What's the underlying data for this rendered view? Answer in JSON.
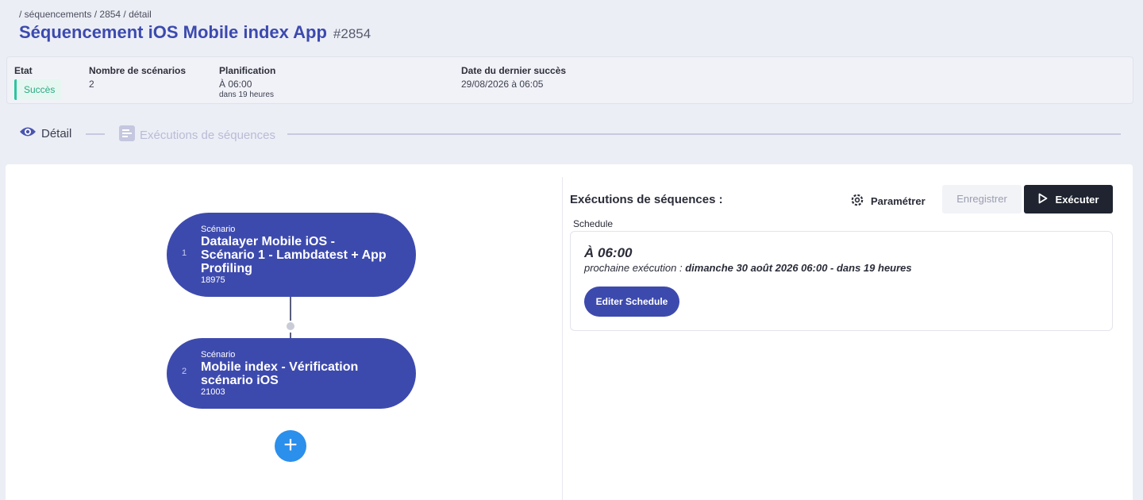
{
  "breadcrumb": "/ séquencements / 2854 / détail",
  "title": "Séquencement iOS Mobile index App",
  "title_id": "#2854",
  "info": {
    "etat_label": "Etat",
    "etat_value": "Succès",
    "scenarios_label": "Nombre de scénarios",
    "scenarios_value": "2",
    "planif_label": "Planification",
    "planif_value": "À 06:00",
    "planif_sub": "dans 19 heures",
    "last_label": "Date du dernier succès",
    "last_value": "29/08/2026 à 06:05"
  },
  "tabs": {
    "detail": "Détail",
    "executions": "Exécutions de séquences"
  },
  "nodes": [
    {
      "num": "1",
      "kind": "Scénario",
      "name": "Datalayer Mobile iOS - Scénario 1 - Lambdatest + App Profiling",
      "code": "18975"
    },
    {
      "num": "2",
      "kind": "Scénario",
      "name": "Mobile index - Vérification scénario iOS",
      "code": "21003"
    }
  ],
  "add_label": "+",
  "panel": {
    "title": "Exécutions de séquences :",
    "param_label": "Paramétrer",
    "save_label": "Enregistrer",
    "exec_label": "Exécuter",
    "schedule_label": "Schedule",
    "schedule_time": "À 06:00",
    "next_prefix": "prochaine exécution :",
    "next_value": "dimanche 30 août 2026 06:00 - dans 19 heures",
    "edit_label": "Editer Schedule"
  },
  "colors": {
    "primary": "#3d4aad",
    "success": "#2aa882",
    "add": "#2b8fec",
    "dark": "#1f2430"
  }
}
